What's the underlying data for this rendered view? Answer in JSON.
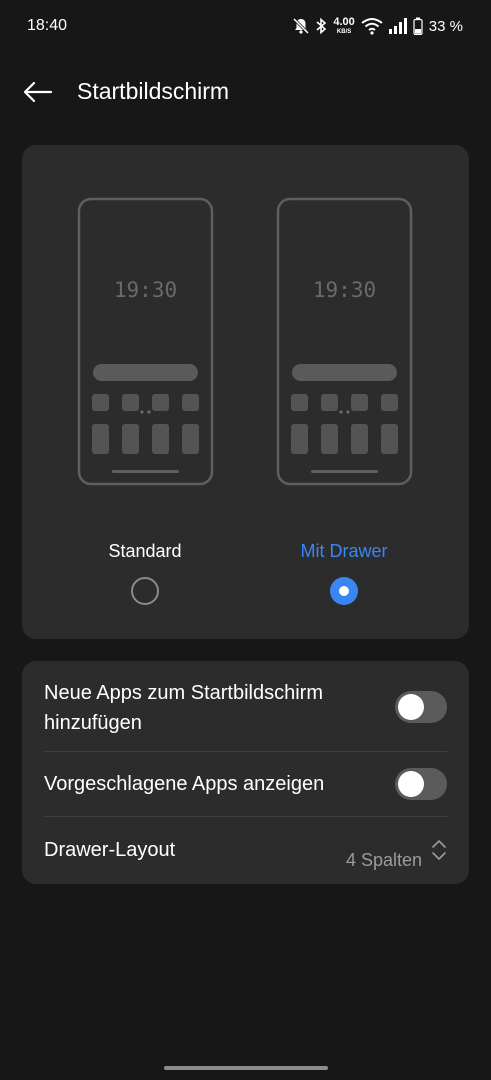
{
  "status_bar": {
    "time": "18:40",
    "net_speed_value": "4.00",
    "net_speed_unit": "KB/S",
    "battery_percent": "33 %",
    "icons": [
      "bell-off-icon",
      "bluetooth-icon",
      "wifi-icon",
      "signal-icon",
      "battery-icon"
    ]
  },
  "header": {
    "title": "Startbildschirm",
    "back_icon": "arrow-left-icon"
  },
  "layout_options": {
    "preview_time": "19:30",
    "items": [
      {
        "label": "Standard",
        "selected": false
      },
      {
        "label": "Mit Drawer",
        "selected": true
      }
    ]
  },
  "settings": {
    "add_new_apps": {
      "label_line1": "Neue Apps zum Startbildschirm",
      "label_line2": "hinzufügen",
      "enabled": false
    },
    "suggested_apps": {
      "label": "Vorgeschlagene Apps anzeigen",
      "enabled": false
    },
    "drawer_layout": {
      "label": "Drawer-Layout",
      "value": "4 Spalten"
    }
  },
  "colors": {
    "background": "#171717",
    "card": "#2c2c2c",
    "accent": "#3a86f5",
    "toggle_off": "#5b5b5b",
    "secondary_text": "#9b9b9b"
  }
}
